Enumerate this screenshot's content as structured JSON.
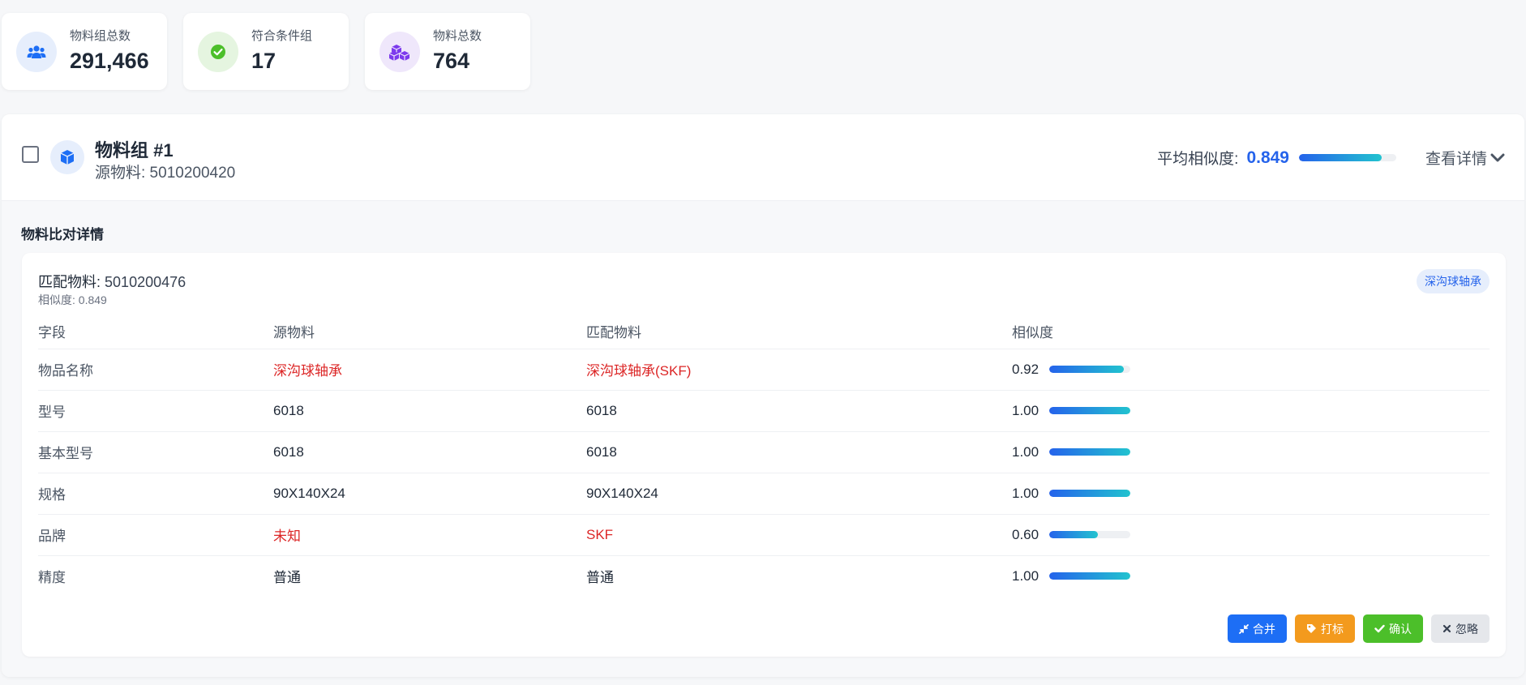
{
  "stats": [
    {
      "label": "物料组总数",
      "value": "291,466",
      "icon": "users-icon",
      "color": "#1d6ef5"
    },
    {
      "label": "符合条件组",
      "value": "17",
      "icon": "check-circle-icon",
      "color": "#4cbf2a"
    },
    {
      "label": "物料总数",
      "value": "764",
      "icon": "cubes-icon",
      "color": "#7c3aed"
    }
  ],
  "group": {
    "title": "物料组 #1",
    "source_label": "源物料: 5010200420",
    "avg_similarity_label": "平均相似度:",
    "avg_similarity": "0.849",
    "avg_similarity_fraction": 0.849,
    "view_detail_label": "查看详情",
    "section_title": "物料比对详情"
  },
  "match": {
    "title_label": "匹配物料:",
    "title_value": "5010200476",
    "similarity_text": "相似度: 0.849",
    "tag": "深沟球轴承",
    "columns": [
      "字段",
      "源物料",
      "匹配物料",
      "相似度"
    ],
    "rows": [
      {
        "field": "物品名称",
        "source": "深沟球轴承",
        "target": "深沟球轴承(SKF)",
        "similarity": "0.92",
        "fraction": 0.92,
        "diff": true
      },
      {
        "field": "型号",
        "source": "6018",
        "target": "6018",
        "similarity": "1.00",
        "fraction": 1.0,
        "diff": false
      },
      {
        "field": "基本型号",
        "source": "6018",
        "target": "6018",
        "similarity": "1.00",
        "fraction": 1.0,
        "diff": false
      },
      {
        "field": "规格",
        "source": "90X140X24",
        "target": "90X140X24",
        "similarity": "1.00",
        "fraction": 1.0,
        "diff": false
      },
      {
        "field": "品牌",
        "source": "未知",
        "target": "SKF",
        "similarity": "0.60",
        "fraction": 0.6,
        "diff": true
      },
      {
        "field": "精度",
        "source": "普通",
        "target": "普通",
        "similarity": "1.00",
        "fraction": 1.0,
        "diff": false
      }
    ],
    "actions": {
      "merge": "合并",
      "mark": "打标",
      "confirm": "确认",
      "ignore": "忽略"
    }
  }
}
